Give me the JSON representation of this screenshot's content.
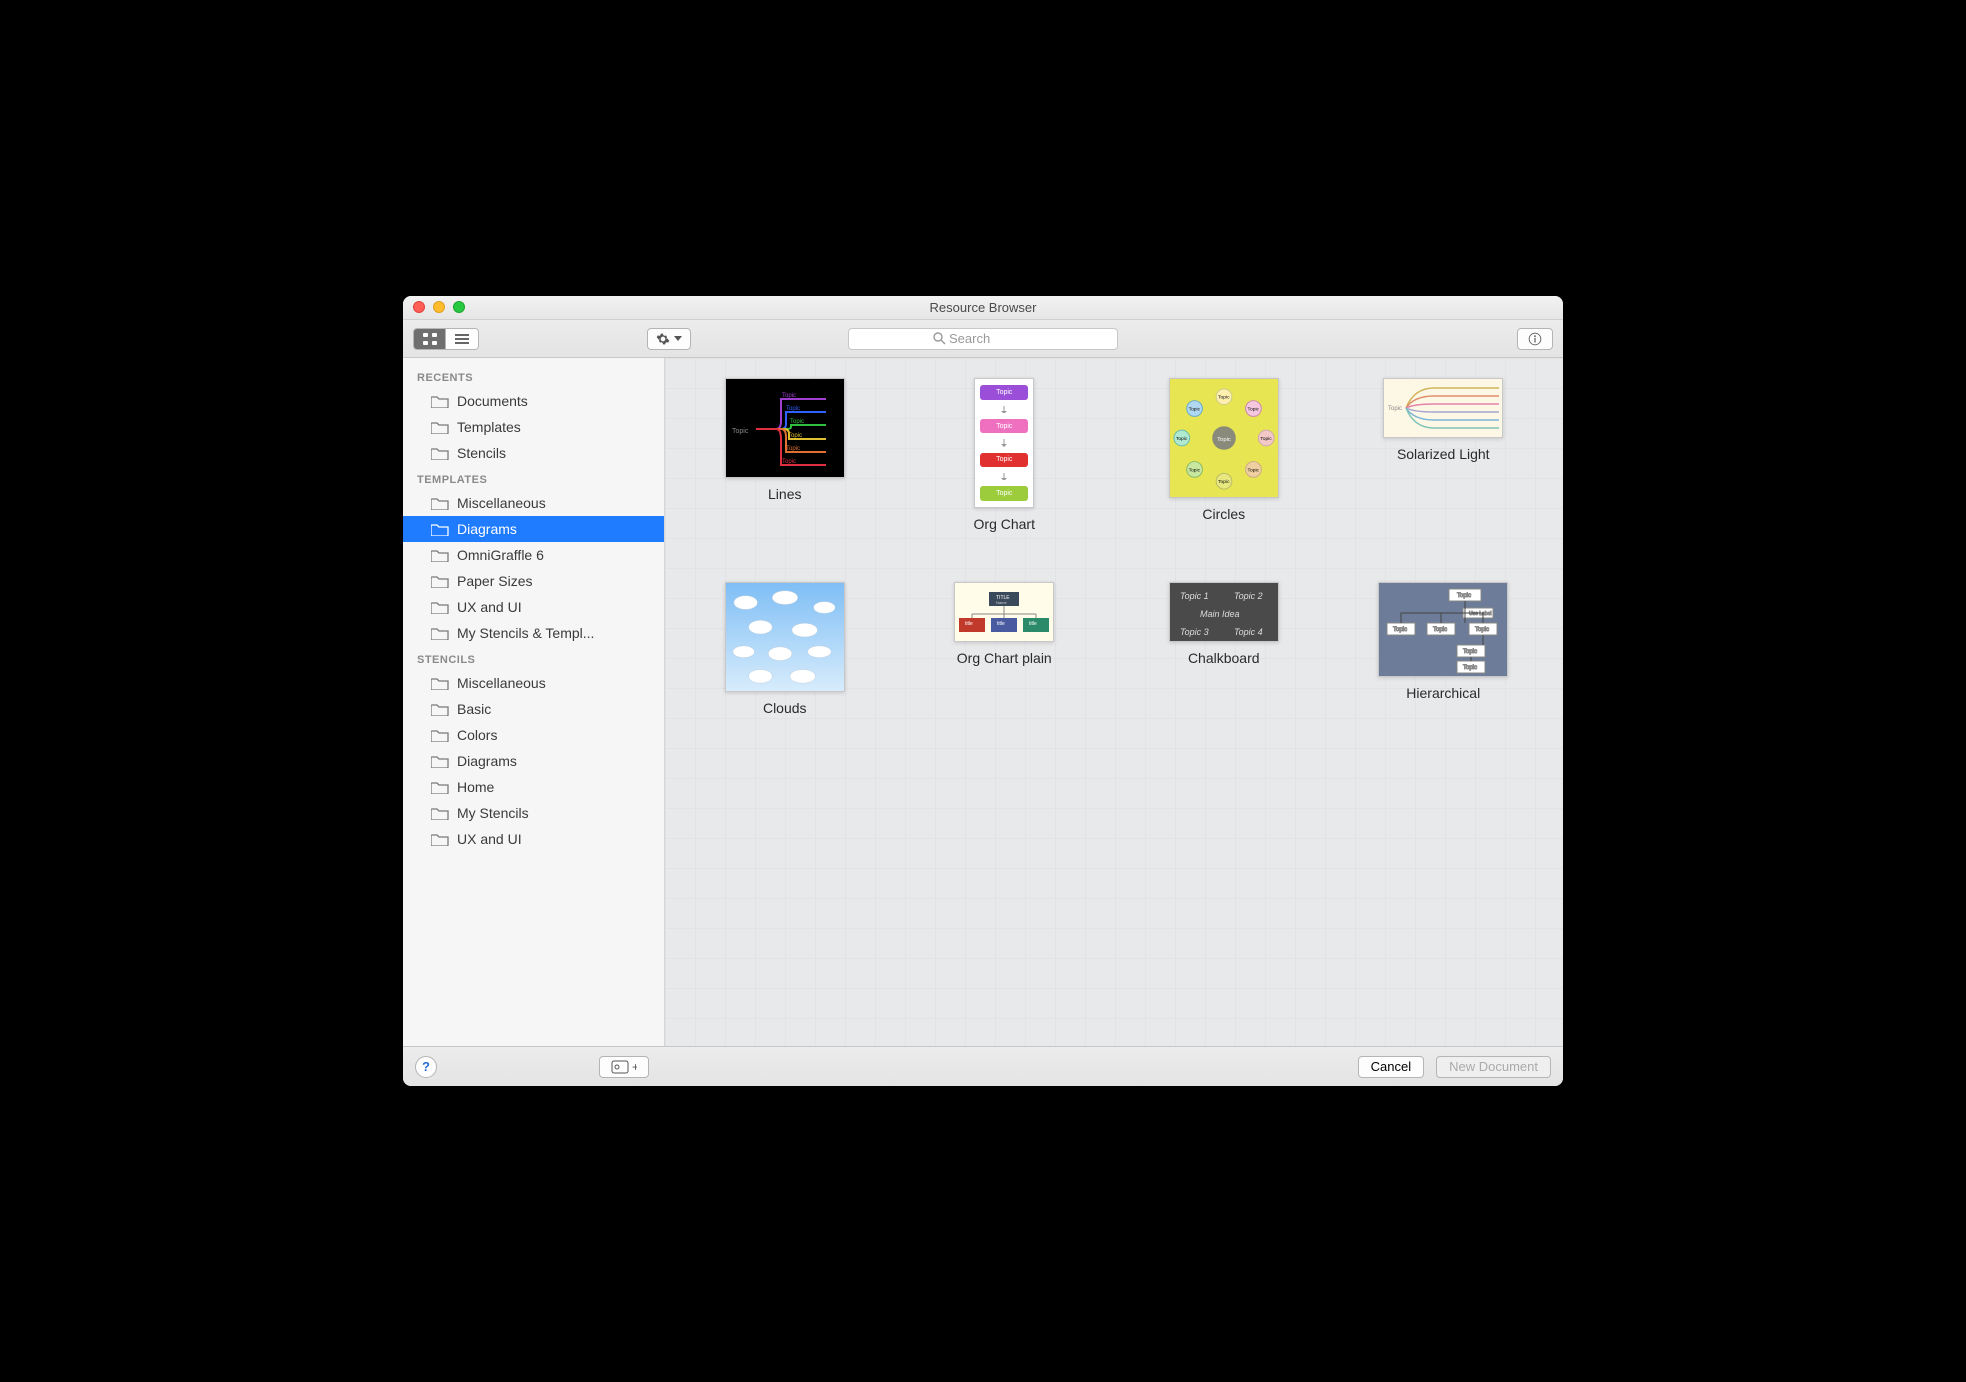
{
  "window": {
    "title": "Resource Browser"
  },
  "toolbar": {
    "search_placeholder": "Search"
  },
  "sidebar": {
    "sections": [
      {
        "header": "RECENTS",
        "items": [
          {
            "label": "Documents"
          },
          {
            "label": "Templates"
          },
          {
            "label": "Stencils"
          }
        ]
      },
      {
        "header": "TEMPLATES",
        "items": [
          {
            "label": "Miscellaneous"
          },
          {
            "label": "Diagrams",
            "selected": true
          },
          {
            "label": "OmniGraffle 6"
          },
          {
            "label": "Paper Sizes"
          },
          {
            "label": "UX and UI"
          },
          {
            "label": "My Stencils & Templ..."
          }
        ]
      },
      {
        "header": "STENCILS",
        "items": [
          {
            "label": "Miscellaneous"
          },
          {
            "label": "Basic"
          },
          {
            "label": "Colors"
          },
          {
            "label": "Diagrams"
          },
          {
            "label": "Home"
          },
          {
            "label": "My Stencils"
          },
          {
            "label": "UX and UI"
          }
        ]
      }
    ]
  },
  "templates": [
    {
      "name": "Lines",
      "key": "lines"
    },
    {
      "name": "Org Chart",
      "key": "orgchart"
    },
    {
      "name": "Circles",
      "key": "circles"
    },
    {
      "name": "Solarized Light",
      "key": "solar"
    },
    {
      "name": "Clouds",
      "key": "clouds"
    },
    {
      "name": "Org Chart plain",
      "key": "orgplain"
    },
    {
      "name": "Chalkboard",
      "key": "chalk"
    },
    {
      "name": "Hierarchical",
      "key": "hier"
    }
  ],
  "footer": {
    "cancel_label": "Cancel",
    "new_doc_label": "New Document"
  }
}
